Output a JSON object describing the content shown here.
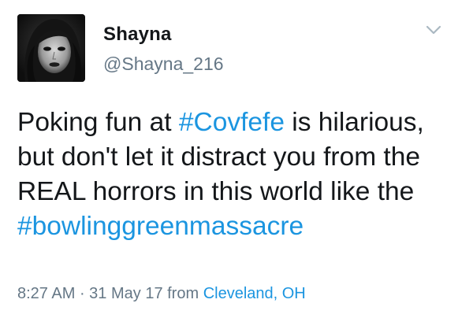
{
  "user": {
    "display_name": "Shayna",
    "handle": "@Shayna_216",
    "avatar_icon": "profile-photo"
  },
  "menu": {
    "icon": "chevron-down-icon"
  },
  "tweet": {
    "segments": [
      {
        "text": "Poking fun at ",
        "type": "text"
      },
      {
        "text": "#Covfefe",
        "type": "hashtag"
      },
      {
        "text": " is hilarious, but don't let it distract you from the REAL horrors in this world like the ",
        "type": "text"
      },
      {
        "text": "#bowlinggreenmassacre",
        "type": "hashtag"
      }
    ]
  },
  "meta": {
    "time": "8:27 AM",
    "separator": " · ",
    "date": "31 May 17",
    "from_label": " from ",
    "location": "Cleveland, OH"
  },
  "colors": {
    "link": "#1b95e0",
    "secondary_text": "#657786",
    "primary_text": "#14171a"
  }
}
